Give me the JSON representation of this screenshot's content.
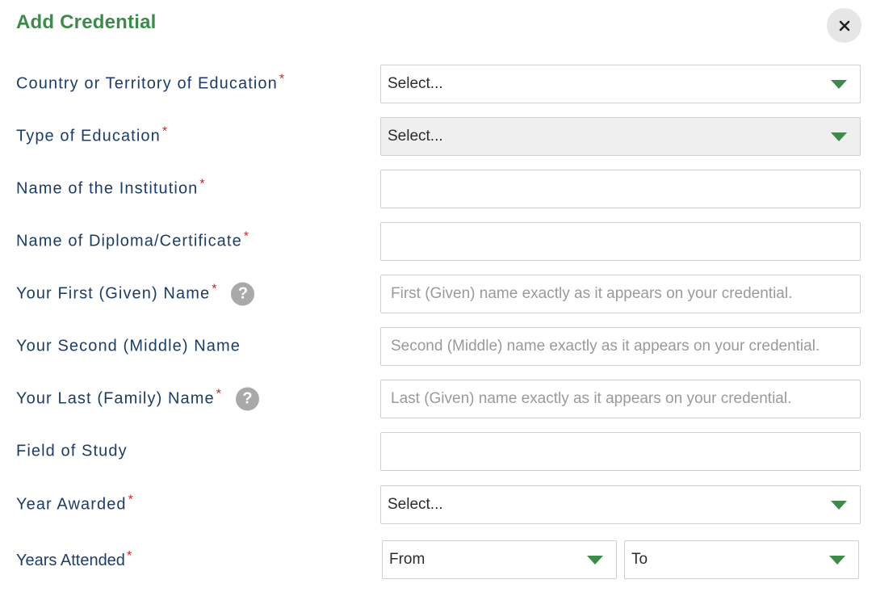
{
  "dialog": {
    "title": "Add Credential",
    "close_icon": "close-icon"
  },
  "colors": {
    "accent_green": "#3e8a4c",
    "label_navy": "#1c3d66",
    "required_red": "#c8202a",
    "help_gray": "#a9a9a9"
  },
  "form": {
    "required_mark": "*",
    "help_glyph": "?",
    "country": {
      "label": "Country or Territory of Education",
      "value": "Select..."
    },
    "education_type": {
      "label": "Type of Education",
      "value": "Select..."
    },
    "institution": {
      "label": "Name of the Institution",
      "value": ""
    },
    "diploma": {
      "label": "Name of Diploma/Certificate",
      "value": ""
    },
    "first_name": {
      "label": "Your First (Given) Name",
      "placeholder": "First (Given) name exactly as it appears on your credential."
    },
    "middle_name": {
      "label": "Your Second (Middle) Name",
      "placeholder": "Second (Middle) name exactly as it appears on your credential."
    },
    "last_name": {
      "label": "Your Last (Family) Name",
      "placeholder": "Last (Given) name exactly as it appears on your credential."
    },
    "field_of_study": {
      "label": "Field of Study",
      "value": ""
    },
    "year_awarded": {
      "label": "Year Awarded",
      "value": "Select..."
    },
    "years_attended": {
      "label": "Years Attended",
      "from": "From",
      "to": "To"
    }
  }
}
